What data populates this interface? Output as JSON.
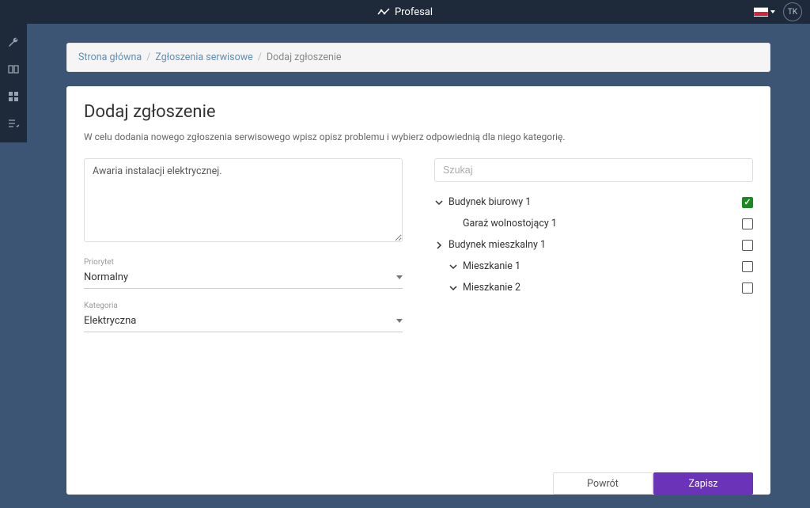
{
  "app": {
    "name": "Profesal",
    "user_initials": "TK"
  },
  "breadcrumb": {
    "home": "Strona główna",
    "section": "Zgłoszenia serwisowe",
    "current": "Dodaj zgłoszenie"
  },
  "page": {
    "title": "Dodaj zgłoszenie",
    "subtitle": "W celu dodania nowego zgłoszenia serwisowego wpisz opisz problemu i wybierz odpowiednią dla niego kategorię."
  },
  "form": {
    "description_value": "Awaria instalacji elektrycznej.",
    "priority_label": "Priorytet",
    "priority_value": "Normalny",
    "category_label": "Kategoria",
    "category_value": "Elektryczna",
    "search_placeholder": "Szukaj"
  },
  "tree": {
    "items": [
      {
        "label": "Budynek biurowy 1",
        "indent": 0,
        "expand": "down",
        "checked": true
      },
      {
        "label": "Garaż wolnostojący 1",
        "indent": 1,
        "expand": "none",
        "checked": false
      },
      {
        "label": "Budynek mieszkalny 1",
        "indent": 0,
        "expand": "right",
        "checked": false
      },
      {
        "label": "Mieszkanie 1",
        "indent": 1,
        "expand": "down",
        "checked": false
      },
      {
        "label": "Mieszkanie 2",
        "indent": 1,
        "expand": "down",
        "checked": false
      }
    ]
  },
  "buttons": {
    "back": "Powrót",
    "save": "Zapisz"
  }
}
